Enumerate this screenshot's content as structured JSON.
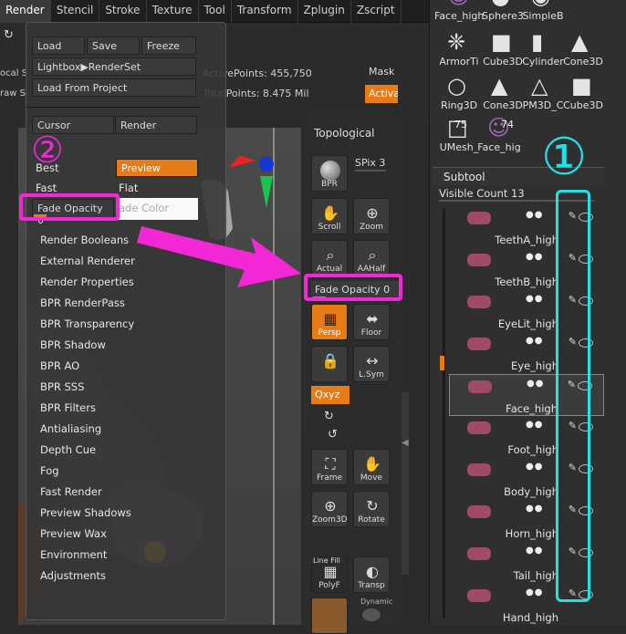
{
  "menu": {
    "items": [
      "Render",
      "Stencil",
      "Stroke",
      "Texture",
      "Tool",
      "Transform",
      "Zplugin",
      "Zscript"
    ]
  },
  "top": {
    "active_points": "ActivePoints: 455,750",
    "total_points": "TotalPoints: 8.475 Mil",
    "mask_label": "Mask",
    "activate_label": "Activa",
    "local_label": "ocal S",
    "draw_label": "raw S"
  },
  "dropdown": {
    "load": "Load",
    "save": "Save",
    "freeze": "Freeze",
    "lightbox": "Lightbox▶RenderSet",
    "load_project": "Load From Project",
    "cursor": "Cursor",
    "render": "Render",
    "best": "Best",
    "preview": "Preview",
    "fast": "Fast",
    "flat": "Flat",
    "fade_opacity": "Fade Opacity 0",
    "fade_color": "ade Color",
    "items": [
      "Render Booleans",
      "External Renderer",
      "Render Properties",
      "BPR RenderPass",
      "BPR Transparency",
      "BPR Shadow",
      "BPR AO",
      "BPR SSS",
      "BPR Filters",
      "Antialiasing",
      "Depth Cue",
      "Fog",
      "Fast Render",
      "Preview Shadows",
      "Preview Wax",
      "Environment",
      "Adjustments"
    ]
  },
  "shelf": {
    "topological": "Topological",
    "spix": "SPix 3",
    "bpr": "BPR",
    "scroll": "Scroll",
    "zoom": "Zoom",
    "actual": "Actual",
    "aahalf": "AAHalf",
    "fade_opacity": "Fade Opacity 0",
    "persp": "Persp",
    "floor": "Floor",
    "lsym": "L.Sym",
    "xyz": "Qxyz",
    "frame": "Frame",
    "move": "Move",
    "zoom3d": "Zoom3D",
    "rotate": "Rotate",
    "linefill": "Line Fill",
    "polyf": "PolyF",
    "transp": "Transp",
    "dynamic": "Dynamic"
  },
  "tools": [
    {
      "label": "Face_high",
      "icon": "face-thumb-icon"
    },
    {
      "label": "Sphere3",
      "icon": "sphere-icon"
    },
    {
      "label": "SimpleB",
      "icon": "simple-brush-icon"
    },
    {
      "label": "ArmorTi",
      "icon": "armor-icon"
    },
    {
      "label": "Cube3D",
      "icon": "cube-icon"
    },
    {
      "label": "Cylinder",
      "icon": "cylinder-icon"
    },
    {
      "label": "Cone3D",
      "icon": "cone-icon"
    },
    {
      "label": "Ring3D",
      "icon": "ring-icon"
    },
    {
      "label": "Cone3D",
      "icon": "cone-icon"
    },
    {
      "label": "PM3D_C",
      "icon": "pm3d-icon"
    },
    {
      "label": "Cube3D",
      "icon": "cube-icon"
    },
    {
      "label": "UMesh_",
      "icon": "umesh-icon"
    },
    {
      "label": "Face_hig",
      "icon": "face-thumb-icon"
    }
  ],
  "tool_badges": {
    "umesh": "75",
    "face": "74"
  },
  "subtool": {
    "title": "Subtool",
    "visible_count": "Visible Count 13",
    "rows": [
      "TeethA_high",
      "TeethB_high",
      "EyeLit_high",
      "Eye_high",
      "Face_high",
      "Foot_high",
      "Body_high",
      "Horn_high",
      "Tail_high",
      "Hand_high"
    ]
  },
  "annotations": {
    "one": "①",
    "two": "②"
  },
  "colors": {
    "accent_orange": "#e77b16",
    "annotation_cyan": "#24e0e6",
    "annotation_magenta": "#f227d6"
  }
}
